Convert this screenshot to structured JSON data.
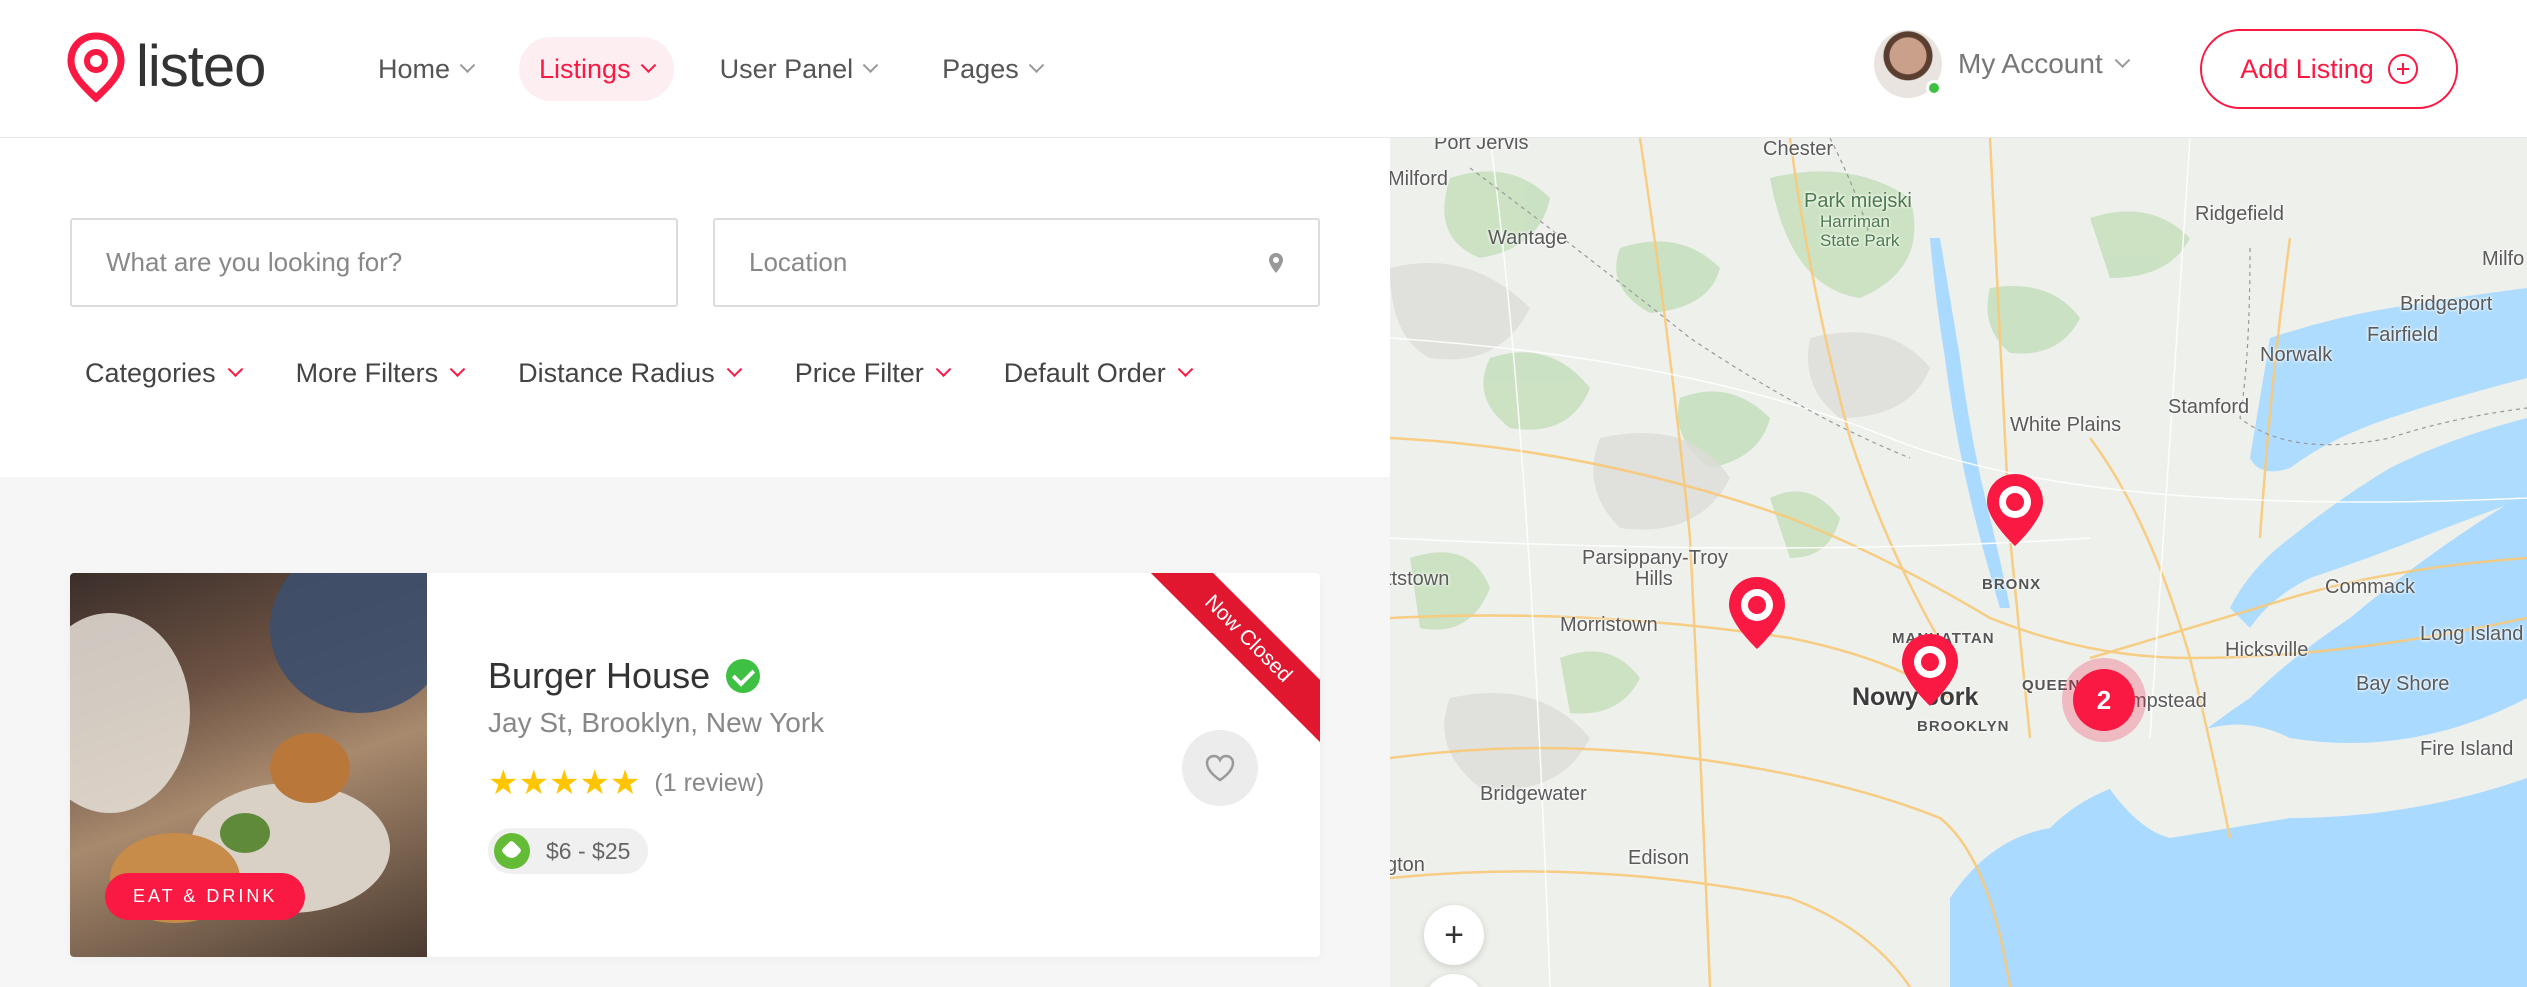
{
  "brand": {
    "name": "listeo",
    "accent": "#f91942"
  },
  "nav": [
    {
      "label": "Home",
      "active": false
    },
    {
      "label": "Listings",
      "active": true
    },
    {
      "label": "User Panel",
      "active": false
    },
    {
      "label": "Pages",
      "active": false
    }
  ],
  "account": {
    "label": "My Account",
    "online": true
  },
  "add_listing": {
    "label": "Add Listing"
  },
  "search": {
    "what_placeholder": "What are you looking for?",
    "location_placeholder": "Location"
  },
  "filters": [
    "Categories",
    "More Filters",
    "Distance Radius",
    "Price Filter",
    "Default Order"
  ],
  "listing": {
    "category": "EAT & DRINK",
    "ribbon": "Now Closed",
    "title": "Burger House",
    "verified": true,
    "address": "Jay St, Brooklyn, New York",
    "rating": 5,
    "stars": "★★★★★",
    "reviews": "(1 review)",
    "price": "$6 - $25"
  },
  "map": {
    "labels": {
      "port_jervis": "Port Jervis",
      "chester": "Chester",
      "milford": "Milford",
      "park_miejski": "Park miejski",
      "harriman": "Harriman",
      "state_park": "State Park",
      "ridgefield": "Ridgefield",
      "milf": "Milfo",
      "wantage": "Wantage",
      "bridgeport": "Bridgeport",
      "fairfield": "Fairfield",
      "norwalk": "Norwalk",
      "stamford": "Stamford",
      "white_plains": "White Plains",
      "parsippany": "Parsippany-Troy",
      "hills": "Hills",
      "ttstown": "ttstown",
      "bronx": "BRONX",
      "commack": "Commack",
      "long_island": "Long Island",
      "morristown": "Morristown",
      "manhattan": "MANHATTAN",
      "hicksville": "Hicksville",
      "queens": "QUEENS",
      "nowy_jork": "Nowy Jork",
      "hempstead": "mpstead",
      "bay_shore": "Bay Shore",
      "brooklyn": "BROOKLYN",
      "fire_island": "Fire Island",
      "bridgewater": "Bridgewater",
      "edison": "Edison",
      "gton": "gton"
    },
    "cluster_count": "2",
    "zoom_in": "+",
    "zoom_out": "−"
  }
}
